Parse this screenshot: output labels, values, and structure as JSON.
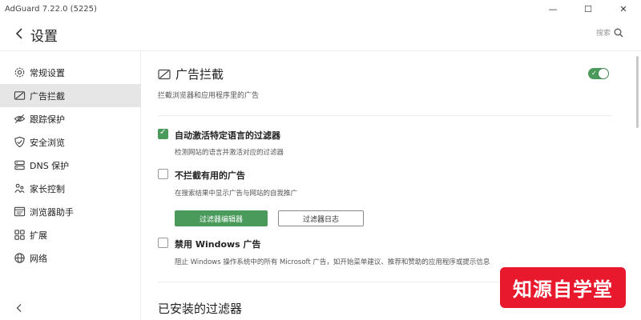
{
  "window": {
    "title": "AdGuard 7.22.0 (5225)",
    "controls": {
      "minimize": "—",
      "maximize": "☐",
      "close": "✕"
    }
  },
  "header": {
    "title": "设置",
    "search_placeholder": "搜索"
  },
  "sidebar": {
    "items": [
      {
        "label": "常规设置",
        "icon": "gear-icon"
      },
      {
        "label": "广告拦截",
        "icon": "ad-block-icon",
        "active": true
      },
      {
        "label": "跟踪保护",
        "icon": "eye-slash-icon"
      },
      {
        "label": "安全浏览",
        "icon": "shield-icon"
      },
      {
        "label": "DNS 保护",
        "icon": "dns-icon"
      },
      {
        "label": "家长控制",
        "icon": "parental-icon"
      },
      {
        "label": "浏览器助手",
        "icon": "browser-icon"
      },
      {
        "label": "扩展",
        "icon": "extensions-icon"
      },
      {
        "label": "网络",
        "icon": "globe-icon"
      }
    ]
  },
  "main": {
    "section_title": "广告拦截",
    "section_desc": "拦截浏览器和应用程序里的广告",
    "toggle_enabled": true,
    "options": [
      {
        "label": "自动激活特定语言的过滤器",
        "desc": "检测网站的语言并激活对应的过滤器",
        "checked": true
      },
      {
        "label": "不拦截有用的广告",
        "desc": "在搜索结果中显示广告与网站的自我推广",
        "checked": false
      },
      {
        "label": "禁用 Windows 广告",
        "desc": "阻止 Windows 操作系统中的所有 Microsoft 广告，如开始菜单建议、推荐和赞助的应用程序或提示信息",
        "checked": false
      }
    ],
    "buttons": {
      "filter_editor": "过滤器编辑器",
      "filter_log": "过滤器日志"
    },
    "installed_title": "已安装的过滤器"
  },
  "watermark": {
    "text": "知源自学堂"
  },
  "colors": {
    "accent": "#4a9a5c",
    "watermark": "#e8192c"
  }
}
